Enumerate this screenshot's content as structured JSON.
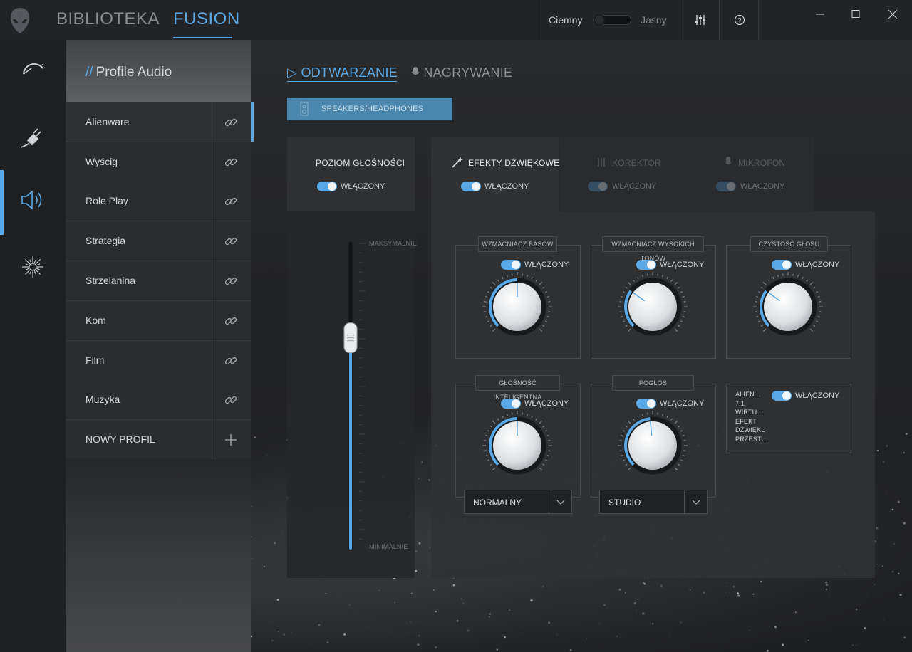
{
  "app": {
    "nav_tabs": [
      "BIBLIOTEKA",
      "FUSION"
    ],
    "active_nav": "FUSION",
    "theme": {
      "dark_label": "Ciemny",
      "light_label": "Jasny"
    },
    "icons": [
      "alien-logo-icon",
      "mixer-icon",
      "help-icon",
      "minimize-icon",
      "maximize-icon",
      "close-icon"
    ]
  },
  "rail": {
    "items": [
      "speedometer-icon",
      "power-plug-icon",
      "speaker-icon",
      "light-burst-icon"
    ],
    "active_index": 2
  },
  "profiles": {
    "title_slash": "//",
    "title": "Profile Audio",
    "items": [
      "Alienware",
      "Wyścig",
      "Role Play",
      "Strategia",
      "Strzelanina",
      "Kom",
      "Film",
      "Muzyka"
    ],
    "active": "Alienware",
    "new_label": "NOWY PROFIL"
  },
  "main": {
    "tab_play": "ODTWARZANIE",
    "tab_record": "NAGRYWANIE",
    "active_tab": "ODTWARZANIE",
    "device": "SPEAKERS/HEADPHONES"
  },
  "volume": {
    "title": "POZIOM GŁOŚNOŚCI",
    "toggle_label": "WŁĄCZONY",
    "toggle_on": true,
    "max_label": "MAKSYMALNIE",
    "min_label": "MINIMALNIE",
    "level": 0.69
  },
  "effects_tabs": {
    "effects": "EFEKTY DŹWIĘKOWE",
    "equalizer": "KOREKTOR",
    "microphone": "MIKROFON",
    "toggle_label": "WŁĄCZONY"
  },
  "effects": {
    "bass": {
      "title": "WZMACNIACZ BASÓW",
      "toggle": "WŁĄCZONY",
      "level": 0.5
    },
    "treble": {
      "title": "WZMACNIACZ WYSOKICH TONÓW",
      "toggle": "WŁĄCZONY",
      "level": 0.3
    },
    "voice": {
      "title": "CZYSTOŚĆ GŁOSU",
      "toggle": "WŁĄCZONY",
      "level": 0.3
    },
    "smart_volume": {
      "title": "GŁOŚNOŚĆ INTELIGENTNA",
      "toggle": "WŁĄCZONY",
      "level": 0.5,
      "mode": "NORMALNY"
    },
    "reverb": {
      "title": "POGŁOS",
      "toggle": "WŁĄCZONY",
      "level": 0.48,
      "mode": "STUDIO"
    },
    "virtual": {
      "lines": [
        "ALIEN…",
        "7.1",
        "WIRTU…",
        "EFEKT",
        "DŹWIĘKU",
        "PRZEST…"
      ],
      "toggle": "WŁĄCZONY"
    }
  },
  "colors": {
    "accent": "#5aa9e6",
    "device_button": "#4a86ad"
  }
}
